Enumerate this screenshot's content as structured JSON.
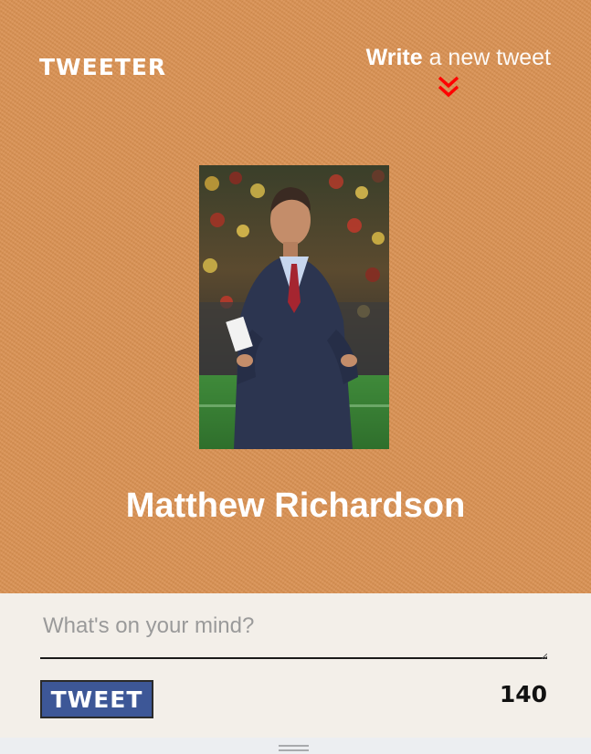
{
  "header": {
    "logo": "TWEETER",
    "write_strong": "Write",
    "write_light": " a new tweet",
    "chevron_icon": "double-chevron-down-icon",
    "accent_color": "#ff0000"
  },
  "profile": {
    "name": "Matthew Richardson",
    "photo": "profile-photo"
  },
  "compose": {
    "placeholder": "What's on your mind?",
    "value": "",
    "button_label": "TWEET",
    "counter": "140",
    "button_color": "#3d5797"
  },
  "colors": {
    "hero_background": "#d99152",
    "compose_background": "#f3efe9"
  }
}
